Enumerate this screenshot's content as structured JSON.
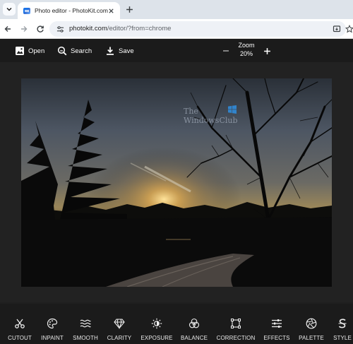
{
  "browser": {
    "tab_title": "Photo editor - PhotoKit.com",
    "url_host": "photokit.com",
    "url_rest": "/editor/?from=chrome"
  },
  "toolbar": {
    "open_label": "Open",
    "search_label": "Search",
    "save_label": "Save",
    "zoom_label": "Zoom",
    "zoom_value": "20%"
  },
  "watermark": {
    "line1": "The",
    "line2": "WindowsClub"
  },
  "tools": [
    {
      "label": "CUTOUT",
      "icon": "scissors-icon"
    },
    {
      "label": "INPAINT",
      "icon": "palette-brush-icon"
    },
    {
      "label": "SMOOTH",
      "icon": "waves-icon"
    },
    {
      "label": "CLARITY",
      "icon": "diamond-icon"
    },
    {
      "label": "EXPOSURE",
      "icon": "sun-icon"
    },
    {
      "label": "BALANCE",
      "icon": "color-circles-icon"
    },
    {
      "label": "CORRECTION",
      "icon": "crop-square-icon"
    },
    {
      "label": "EFFECTS",
      "icon": "sliders-icon"
    },
    {
      "label": "PALETTE",
      "icon": "aperture-icon"
    },
    {
      "label": "STYLE",
      "icon": "style-s-icon"
    }
  ]
}
